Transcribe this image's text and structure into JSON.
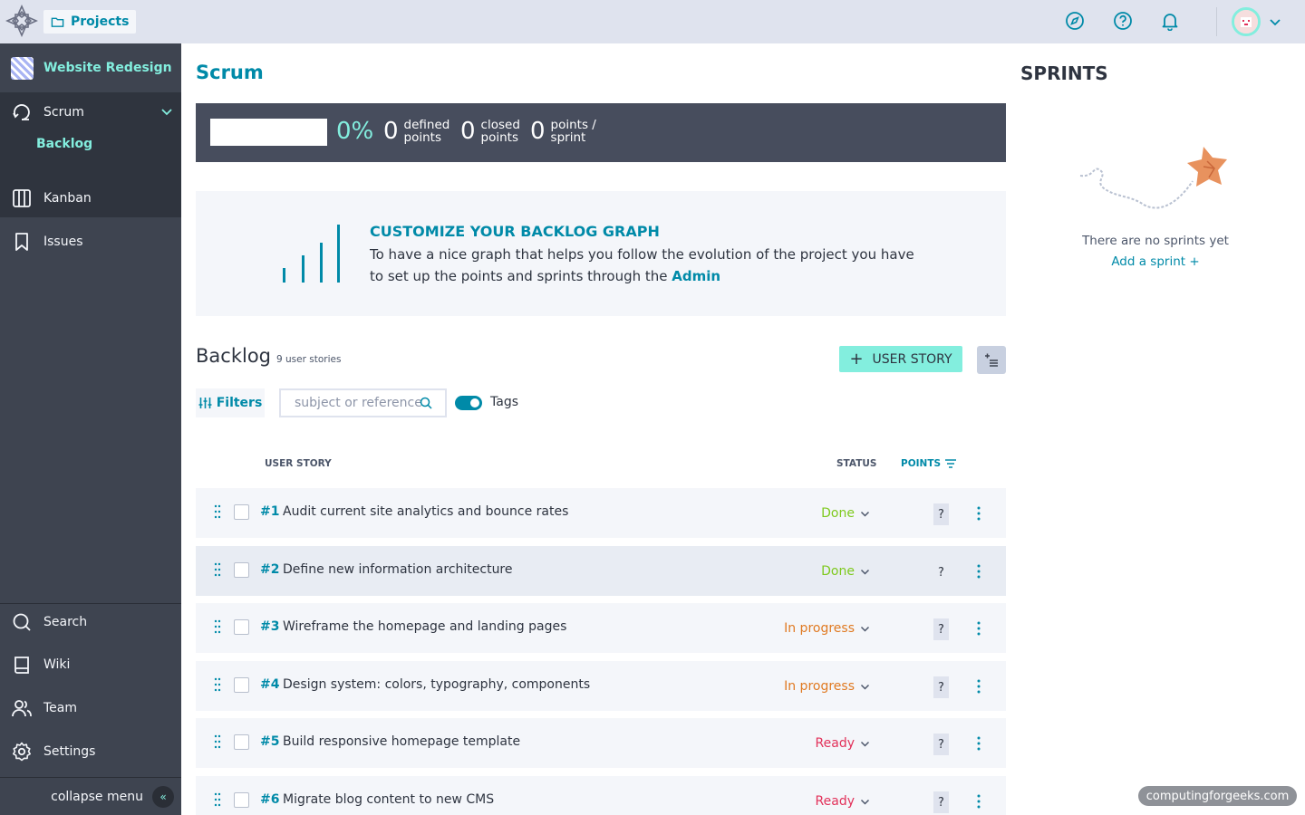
{
  "topbar": {
    "projects_label": "Projects",
    "icons": [
      "compass-icon",
      "help-icon",
      "bell-icon",
      "avatar",
      "chevron-down-icon"
    ]
  },
  "sidebar": {
    "project_name": "Website Redesign",
    "scrum_label": "Scrum",
    "backlog_label": "Backlog",
    "kanban_label": "Kanban",
    "issues_label": "Issues",
    "search_label": "Search",
    "wiki_label": "Wiki",
    "team_label": "Team",
    "settings_label": "Settings",
    "collapse_label": "collapse menu"
  },
  "main": {
    "title": "Scrum",
    "stats": {
      "progress_pct": "0%",
      "progress_value": 0,
      "defined_num": "0",
      "defined_label_1": "defined",
      "defined_label_2": "points",
      "closed_num": "0",
      "closed_label_1": "closed",
      "closed_label_2": "points",
      "sprint_num": "0",
      "sprint_label_1": "points /",
      "sprint_label_2": "sprint"
    },
    "graph_card": {
      "title": "CUSTOMIZE YOUR BACKLOG GRAPH",
      "text": "To have a nice graph that helps you follow the evolution of the project you have to set up the points and sprints through the ",
      "link": "Admin"
    },
    "backlog": {
      "title": "Backlog",
      "count": "9 user stories",
      "add_button": "USER STORY",
      "filters_label": "Filters",
      "search_placeholder": "subject or reference",
      "tags_label": "Tags",
      "col_user_story": "USER STORY",
      "col_status": "STATUS",
      "col_points": "POINTS"
    },
    "stories": [
      {
        "ref": "#1",
        "subject": "Audit current site analytics and bounce rates",
        "status": "Done",
        "points": "?"
      },
      {
        "ref": "#2",
        "subject": "Define new information architecture",
        "status": "Done",
        "points": "?"
      },
      {
        "ref": "#3",
        "subject": "Wireframe the homepage and landing pages",
        "status": "In progress",
        "points": "?"
      },
      {
        "ref": "#4",
        "subject": "Design system: colors, typography, components",
        "status": "In progress",
        "points": "?"
      },
      {
        "ref": "#5",
        "subject": "Build responsive homepage template",
        "status": "Ready",
        "points": "?"
      },
      {
        "ref": "#6",
        "subject": "Migrate blog content to new CMS",
        "status": "Ready",
        "points": "?"
      }
    ],
    "status_colors": {
      "Done": "#7ec91e",
      "In progress": "#e07a22",
      "Ready": "#e2315a"
    }
  },
  "sprints": {
    "title": "SPRINTS",
    "empty_text": "There are no sprints yet",
    "add_label": "Add a sprint"
  },
  "watermark": "computingforgeeks.com",
  "colors": {
    "accent": "#008aa8",
    "mint": "#83eede",
    "sidebar": "#3e4450",
    "topbar": "#dfe3ee"
  }
}
